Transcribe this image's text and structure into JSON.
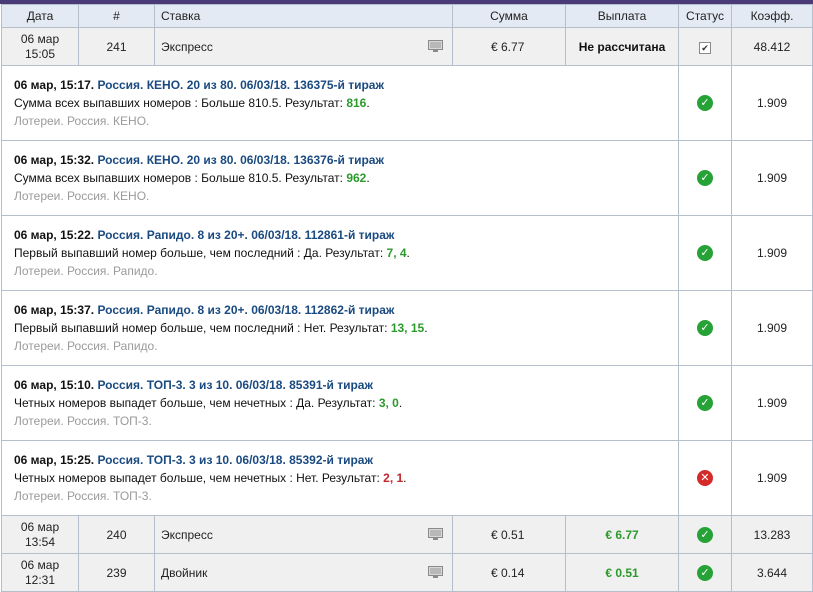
{
  "header": {
    "date": "Дата",
    "num": "#",
    "stake": "Ставка",
    "amount": "Сумма",
    "payout": "Выплата",
    "status": "Статус",
    "coef": "Коэфф."
  },
  "bets": [
    {
      "date_line1": "06 мар",
      "date_line2": "15:05",
      "num": "241",
      "type": "Экспресс",
      "amount": "€ 6.77",
      "payout": "Не рассчитана",
      "coef": "48.412"
    },
    {
      "date_line1": "06 мар",
      "date_line2": "13:54",
      "num": "240",
      "type": "Экспресс",
      "amount": "€ 0.51",
      "payout": "€ 6.77",
      "coef": "13.283"
    },
    {
      "date_line1": "06 мар",
      "date_line2": "12:31",
      "num": "239",
      "type": "Двойник",
      "amount": "€ 0.14",
      "payout": "€ 0.51",
      "coef": "3.644"
    }
  ],
  "events": [
    {
      "time": "06 мар, 15:17.",
      "name": "Россия. КЕНО. 20 из 80. 06/03/18. 136375-й тираж",
      "market": "Сумма всех выпавших номеров : Больше 810.5. Результат:",
      "result": "816",
      "league": "Лотереи. Россия. КЕНО.",
      "status": "won",
      "coef": "1.909"
    },
    {
      "time": "06 мар, 15:32.",
      "name": "Россия. КЕНО. 20 из 80. 06/03/18. 136376-й тираж",
      "market": "Сумма всех выпавших номеров : Больше 810.5. Результат:",
      "result": "962",
      "league": "Лотереи. Россия. КЕНО.",
      "status": "won",
      "coef": "1.909"
    },
    {
      "time": "06 мар, 15:22.",
      "name": "Россия. Рапидо. 8 из 20+. 06/03/18. 112861-й тираж",
      "market": "Первый выпавший номер больше, чем последний : Да. Результат:",
      "result": "7, 4",
      "league": "Лотереи. Россия. Рапидо.",
      "status": "won",
      "coef": "1.909"
    },
    {
      "time": "06 мар, 15:37.",
      "name": "Россия. Рапидо. 8 из 20+. 06/03/18. 112862-й тираж",
      "market": "Первый выпавший номер больше, чем последний : Нет. Результат:",
      "result": "13, 15",
      "league": "Лотереи. Россия. Рапидо.",
      "status": "won",
      "coef": "1.909"
    },
    {
      "time": "06 мар, 15:10.",
      "name": "Россия. ТОП-3. 3 из 10. 06/03/18. 85391-й тираж",
      "market": "Четных номеров выпадет больше, чем нечетных : Да. Результат:",
      "result": "3, 0",
      "league": "Лотереи. Россия. ТОП-3.",
      "status": "won",
      "coef": "1.909"
    },
    {
      "time": "06 мар, 15:25.",
      "name": "Россия. ТОП-3. 3 из 10. 06/03/18. 85392-й тираж",
      "market": "Четных номеров выпадет больше, чем нечетных : Нет. Результат:",
      "result": "2, 1",
      "league": "Лотереи. Россия. ТОП-3.",
      "status": "lost",
      "coef": "1.909"
    }
  ],
  "colors": {
    "accent_bar": "#4a3a78",
    "header_bg": "#e4eaf3",
    "win_green": "#27a236",
    "loss_red": "#d42a2a",
    "event_link": "#1a4a80"
  },
  "icons": {
    "status_won": "check-circle-icon",
    "status_lost": "cross-circle-icon",
    "status_pending": "checkbox-icon",
    "details": "monitor-icon"
  }
}
